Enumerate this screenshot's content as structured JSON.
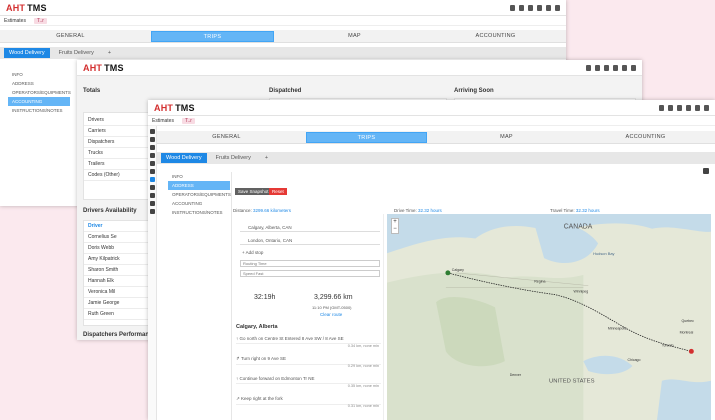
{
  "app": {
    "logo_prefix": "AHT",
    "logo_suffix": "TMS"
  },
  "subbar": {
    "label": "Estimates",
    "tag": "T..r"
  },
  "nav": {
    "tabs": [
      "GENERAL",
      "TRIPS",
      "MAP",
      "ACCOUNTING"
    ],
    "active": "TRIPS"
  },
  "subtabs": {
    "items": [
      "Wood Delivery",
      "Fruits Delivery",
      "+"
    ]
  },
  "sidemenu": {
    "w1": [
      "INFO",
      "ADDRESS",
      "OPERATORS/EQUIPMENTS",
      "ACCOUNTING",
      "INSTRUCTIONS/NOTES"
    ],
    "w3": [
      "INFO",
      "ADDRESS",
      "OPERATORS/EQUIPMENTS",
      "ACCOUNTING",
      "INSTRUCTIONS/NOTES"
    ]
  },
  "dashboard": {
    "totals_title": "Totals",
    "dispatched_title": "Dispatched",
    "arriving_title": "Arriving Soon",
    "totals_items": [
      "Drivers",
      "Carriers",
      "Dispatchers",
      "Trucks",
      "Trailers",
      "Codes (Other)"
    ],
    "drivers_availability_title": "Drivers Availability",
    "drivers_header": "Driver",
    "drivers": [
      "Cornelius Se",
      "Doris Webb",
      "Amy Kilpatrick",
      "Sharon Smith",
      "Hannah Elk",
      "Veronica Mil",
      "Jamie George",
      "Ruth Green"
    ],
    "dispatchers_perf_title": "Dispatchers Performance"
  },
  "trip": {
    "save_label": "Save Snapshot",
    "reset_label": "Reset",
    "distance_label": "Distance:",
    "distance_value": "3299.66 kilometers",
    "drive_label": "Drive Time:",
    "drive_value": "32.32 hours",
    "travel_label": "Travel Time:",
    "travel_value": "32.32 hours",
    "origin": "Calgary, Alberta, CAN",
    "destination": "London, Ontario, CAN",
    "add_stop": "Add stop",
    "select1": "Routing Time",
    "select2": "Speed Fast",
    "duration": "32:19h",
    "distance_big": "3,299.66 km",
    "arrival": "11:10 PM (GMT-0500)",
    "clear": "Clear route",
    "section_title": "Calgary, Alberta",
    "steps": [
      {
        "text": "Go north on Centre St Entered 8 Ave SW / 8 Ave SE",
        "meta": "0.34 km, none min"
      },
      {
        "text": "Turn right on 9 Ave SE",
        "meta": "0.29 km, none min"
      },
      {
        "text": "Continue forward on Edmonton Tr NE",
        "meta": "0.35 km, none min"
      },
      {
        "text": "Keep right at the fork",
        "meta": "0.31 km, none min"
      }
    ]
  },
  "map": {
    "labels": {
      "canada": "CANADA",
      "us": "UNITED STATES",
      "hudson": "Hudson Bay"
    },
    "cities": [
      "Calgary",
      "Regina",
      "Winnipeg",
      "Quebec",
      "Toronto",
      "Chicago",
      "Minneapolis",
      "Denver",
      "Montreal"
    ]
  }
}
